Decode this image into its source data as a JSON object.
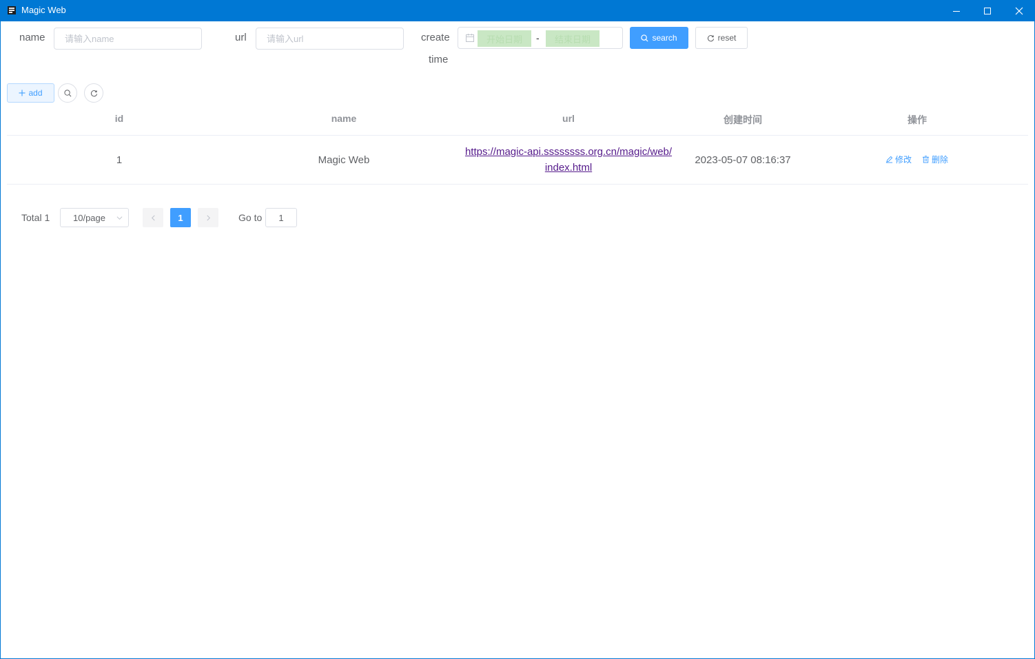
{
  "window": {
    "title": "Magic Web"
  },
  "filters": {
    "name_label": "name",
    "name_placeholder": "请输入name",
    "url_label": "url",
    "url_placeholder": "请输入url",
    "create_time_label_line1": "create",
    "create_time_label_line2": "time",
    "start_date_placeholder": "开始日期",
    "date_separator": "-",
    "end_date_placeholder": "结束日期",
    "search_label": "search",
    "reset_label": "reset"
  },
  "toolbar": {
    "add_label": "add"
  },
  "table": {
    "columns": [
      "id",
      "name",
      "url",
      "创建时间",
      "操作"
    ],
    "rows": [
      {
        "id": "1",
        "name": "Magic Web",
        "url_line1": "https://magic-api.ssssssss.org.cn/magic/web/",
        "url_line2": "index.html",
        "created": "2023-05-07 08:16:37",
        "edit_label": "修改",
        "delete_label": "删除"
      }
    ]
  },
  "pagination": {
    "total": "Total 1",
    "page_size": "10/page",
    "current_page": "1",
    "goto_label": "Go to",
    "goto_value": "1"
  },
  "colors": {
    "titlebar": "#0078d4",
    "primary": "#409eff",
    "link_visited": "#551a8b",
    "date_highlight": "#c9e7c4"
  }
}
